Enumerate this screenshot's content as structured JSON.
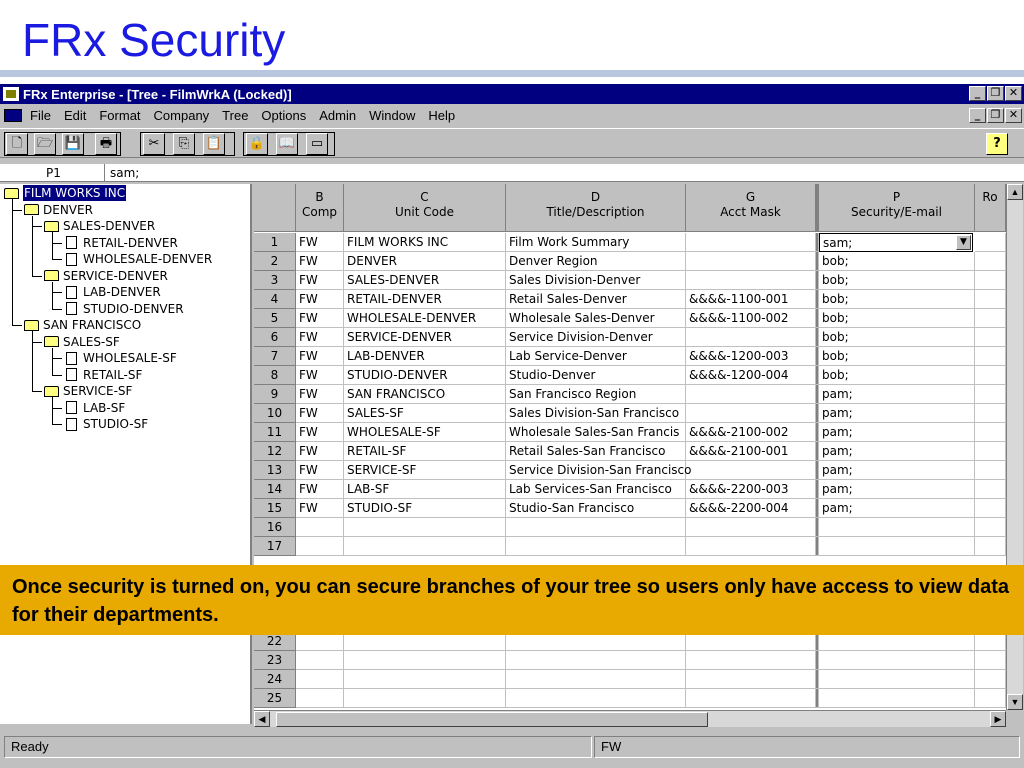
{
  "slide": {
    "title": "FRx Security"
  },
  "window": {
    "title": "FRx Enterprise - [Tree - FilmWrkA (Locked)]",
    "minimize": "_",
    "restore": "❐",
    "close": "✕"
  },
  "menu": [
    "File",
    "Edit",
    "Format",
    "Company",
    "Tree",
    "Options",
    "Admin",
    "Window",
    "Help"
  ],
  "toolbar": {
    "new": "🗋",
    "open": "🗁",
    "save": "💾",
    "print": "🖶",
    "cut": "✂",
    "copy": "⎘",
    "paste": "📋",
    "lock": "🔒",
    "book": "📖",
    "form": "▭",
    "help": "?"
  },
  "formula": {
    "cell": "P1",
    "content": "sam;"
  },
  "tree": [
    {
      "label": "FILM WORKS INC",
      "type": "folder",
      "level": 0,
      "selected": true
    },
    {
      "label": "DENVER",
      "type": "folder",
      "level": 1
    },
    {
      "label": "SALES-DENVER",
      "type": "folder",
      "level": 2
    },
    {
      "label": "RETAIL-DENVER",
      "type": "doc",
      "level": 3
    },
    {
      "label": "WHOLESALE-DENVER",
      "type": "doc",
      "level": 3
    },
    {
      "label": "SERVICE-DENVER",
      "type": "folder",
      "level": 2
    },
    {
      "label": "LAB-DENVER",
      "type": "doc",
      "level": 3
    },
    {
      "label": "STUDIO-DENVER",
      "type": "doc",
      "level": 3
    },
    {
      "label": "SAN FRANCISCO",
      "type": "folder",
      "level": 1
    },
    {
      "label": "SALES-SF",
      "type": "folder",
      "level": 2
    },
    {
      "label": "WHOLESALE-SF",
      "type": "doc",
      "level": 3
    },
    {
      "label": "RETAIL-SF",
      "type": "doc",
      "level": 3
    },
    {
      "label": "SERVICE-SF",
      "type": "folder",
      "level": 2
    },
    {
      "label": "LAB-SF",
      "type": "doc",
      "level": 3
    },
    {
      "label": "STUDIO-SF",
      "type": "doc",
      "level": 3
    }
  ],
  "grid": {
    "columns": [
      {
        "letter": "B",
        "name": "Comp"
      },
      {
        "letter": "C",
        "name": "Unit Code"
      },
      {
        "letter": "D",
        "name": "Title/Description"
      },
      {
        "letter": "G",
        "name": "Acct Mask"
      },
      {
        "letter": "",
        "name": ""
      },
      {
        "letter": "P",
        "name": "Security/E-mail"
      },
      {
        "letter": "",
        "name": "Ro"
      }
    ],
    "rows": [
      [
        "1",
        "FW",
        "FILM WORKS INC",
        "Film Work Summary",
        "",
        "sam;"
      ],
      [
        "2",
        "FW",
        "DENVER",
        "Denver Region",
        "",
        "bob;"
      ],
      [
        "3",
        "FW",
        "SALES-DENVER",
        "Sales Division-Denver",
        "",
        "bob;"
      ],
      [
        "4",
        "FW",
        "RETAIL-DENVER",
        "Retail Sales-Denver",
        "&&&&-1100-001",
        "bob;"
      ],
      [
        "5",
        "FW",
        "WHOLESALE-DENVER",
        "Wholesale Sales-Denver",
        "&&&&-1100-002",
        "bob;"
      ],
      [
        "6",
        "FW",
        "SERVICE-DENVER",
        "Service Division-Denver",
        "",
        "bob;"
      ],
      [
        "7",
        "FW",
        "LAB-DENVER",
        "Lab Service-Denver",
        "&&&&-1200-003",
        "bob;"
      ],
      [
        "8",
        "FW",
        "STUDIO-DENVER",
        "Studio-Denver",
        "&&&&-1200-004",
        "bob;"
      ],
      [
        "9",
        "FW",
        "SAN FRANCISCO",
        "San Francisco Region",
        "",
        "pam;"
      ],
      [
        "10",
        "FW",
        "SALES-SF",
        "Sales Division-San Francisco",
        "",
        "pam;"
      ],
      [
        "11",
        "FW",
        "WHOLESALE-SF",
        "Wholesale Sales-San Francis",
        "&&&&-2100-002",
        "pam;"
      ],
      [
        "12",
        "FW",
        "RETAIL-SF",
        "Retail Sales-San Francisco",
        "&&&&-2100-001",
        "pam;"
      ],
      [
        "13",
        "FW",
        "SERVICE-SF",
        "Service Division-San Francisco",
        "",
        "pam;"
      ],
      [
        "14",
        "FW",
        "LAB-SF",
        "Lab Services-San Francisco",
        "&&&&-2200-003",
        "pam;"
      ],
      [
        "15",
        "FW",
        "STUDIO-SF",
        "Studio-San Francisco",
        "&&&&-2200-004",
        "pam;"
      ],
      [
        "16",
        "",
        "",
        "",
        "",
        ""
      ],
      [
        "17",
        "",
        "",
        "",
        "",
        ""
      ],
      [
        "22",
        "",
        "",
        "",
        "",
        ""
      ],
      [
        "23",
        "",
        "",
        "",
        "",
        ""
      ],
      [
        "24",
        "",
        "",
        "",
        "",
        ""
      ],
      [
        "25",
        "",
        "",
        "",
        "",
        ""
      ]
    ],
    "dropdown_arrow": "▼"
  },
  "scroll": {
    "up": "▲",
    "down": "▼",
    "left": "◀",
    "right": "▶"
  },
  "status": {
    "left": "Ready",
    "right": "FW"
  },
  "callout": "Once security is turned on, you can secure branches of your tree so users only have access to view data for their departments."
}
